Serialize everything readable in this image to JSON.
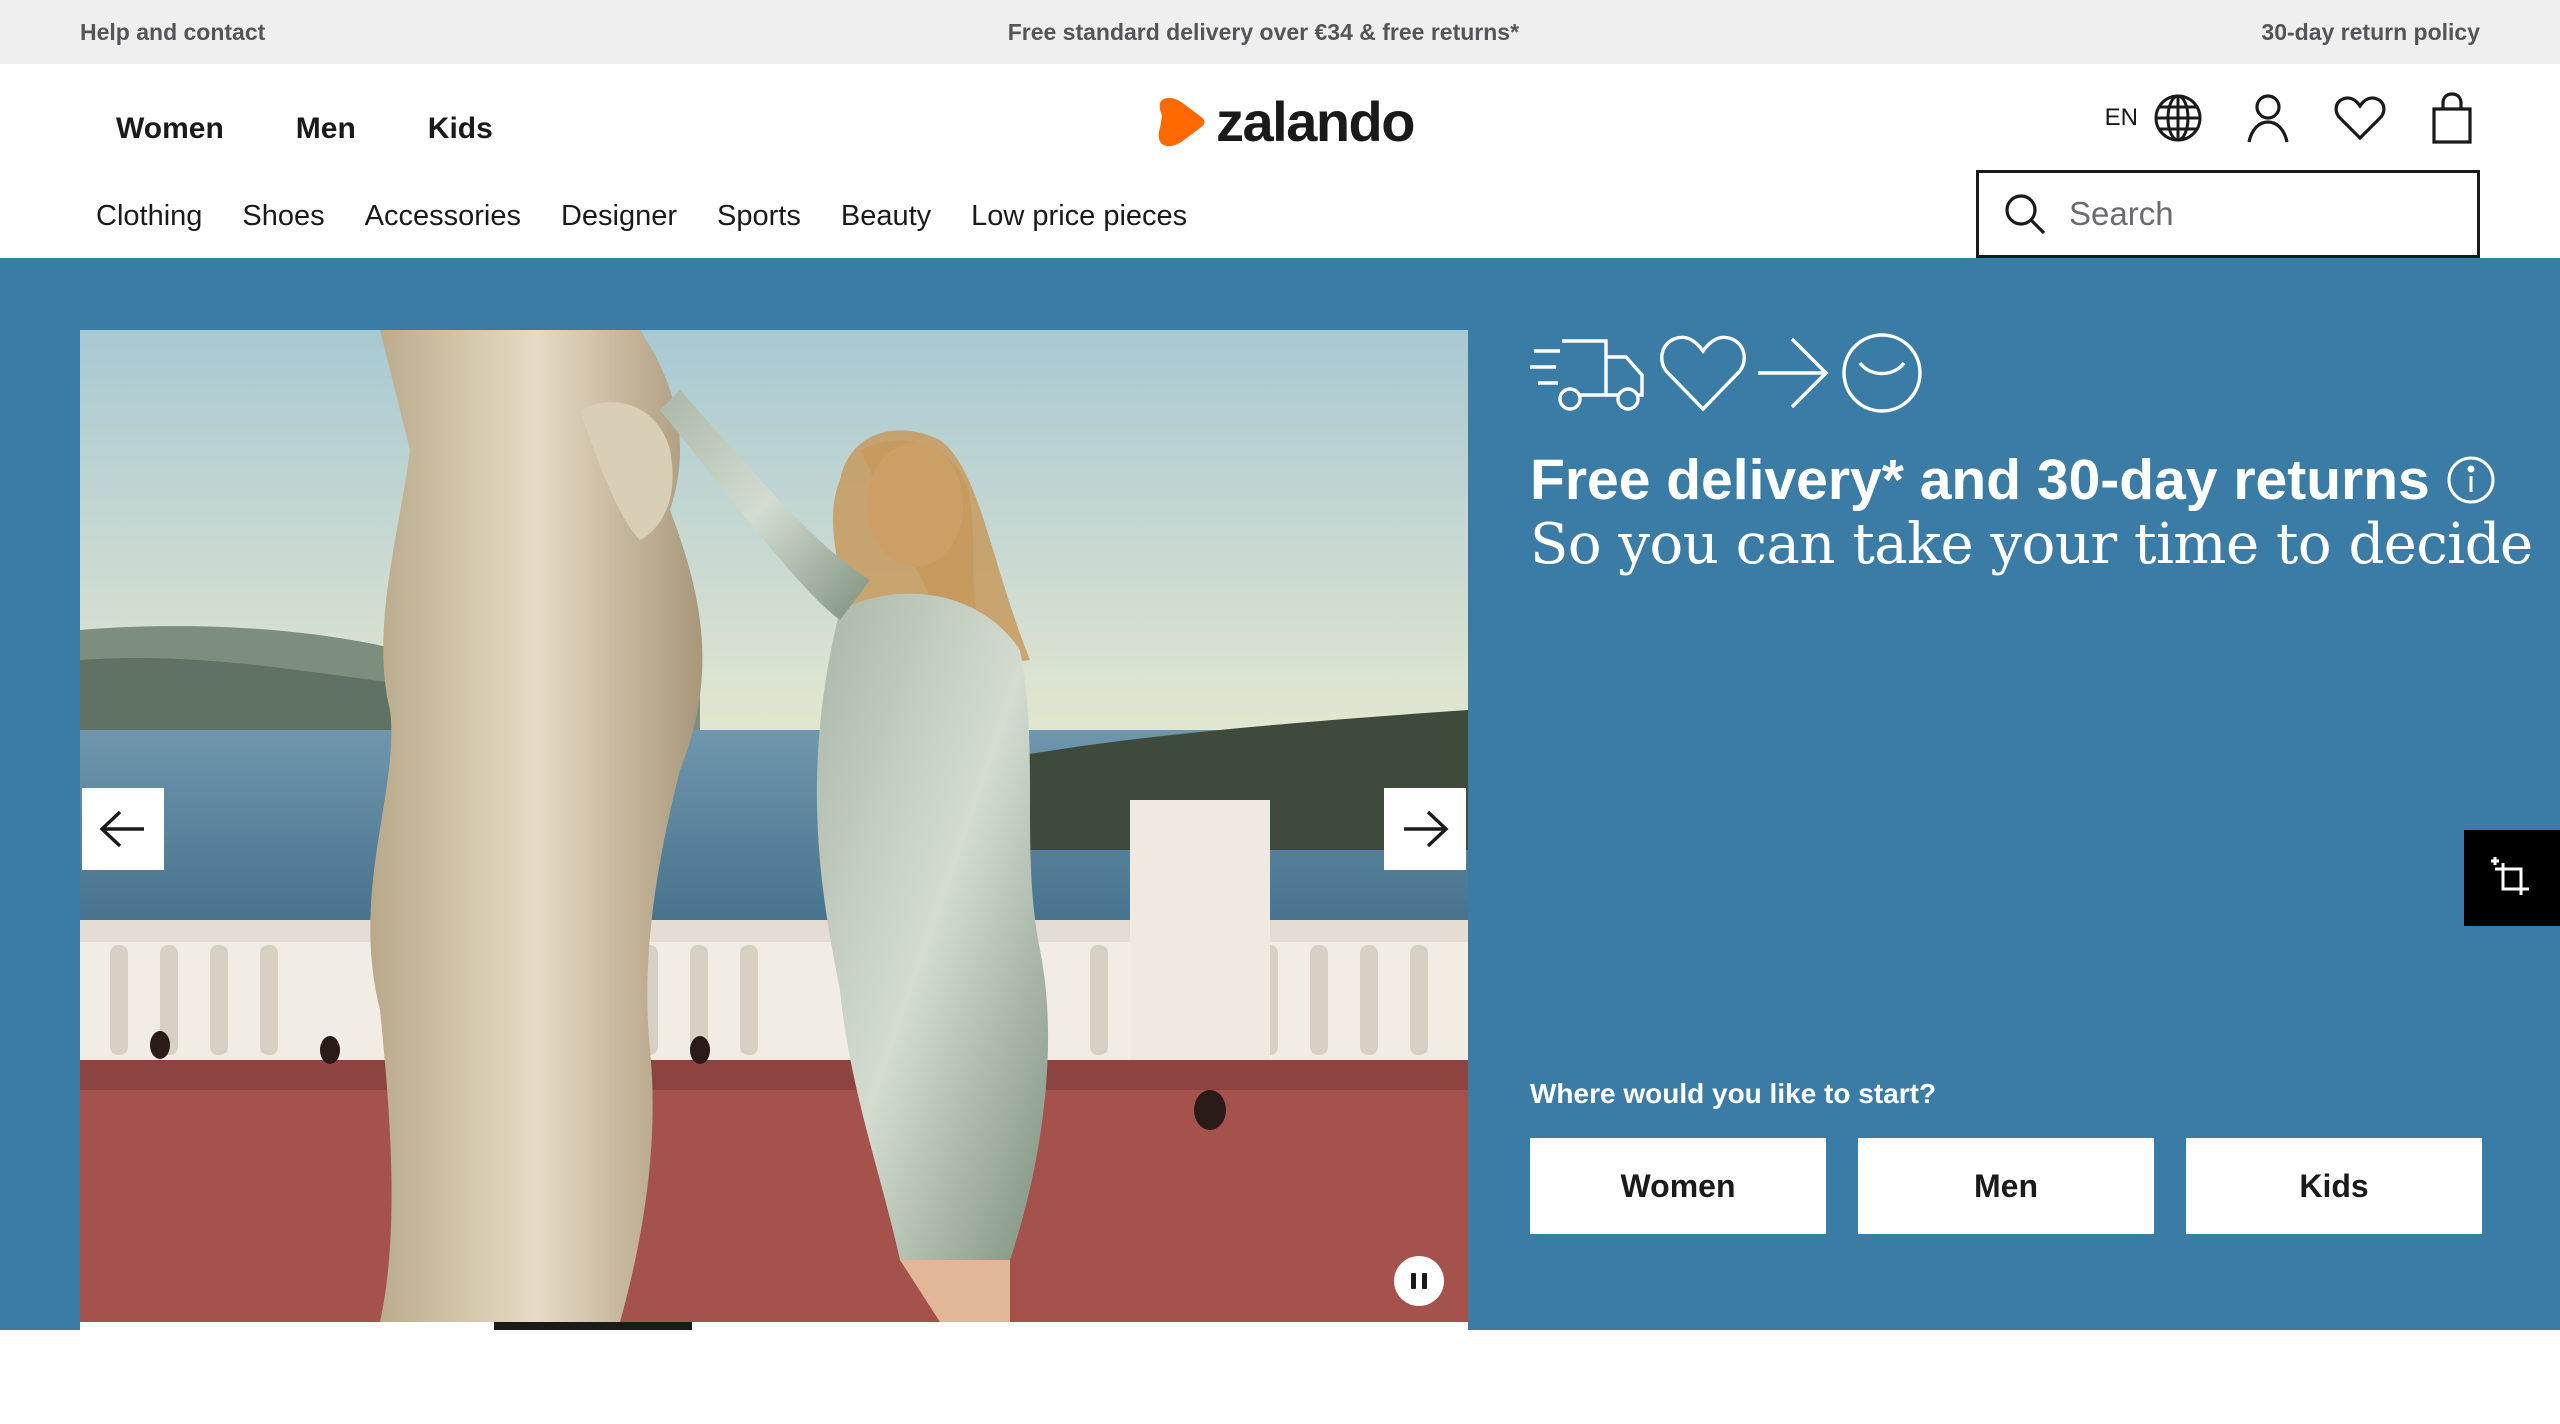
{
  "topbar": {
    "help": "Help and contact",
    "delivery": "Free standard delivery over €34 & free returns*",
    "returns": "30-day return policy"
  },
  "header": {
    "gender_nav": [
      "Women",
      "Men",
      "Kids"
    ],
    "logo_text": "zalando",
    "language": "EN",
    "icons": [
      "globe-icon",
      "account-icon",
      "wishlist-heart-icon",
      "shopping-bag-icon"
    ],
    "categories": [
      "Clothing",
      "Shoes",
      "Accessories",
      "Designer",
      "Sports",
      "Beauty",
      "Low price pieces"
    ],
    "search_placeholder": "Search"
  },
  "hero": {
    "carousel_progress": 0.2,
    "promo_title": "Free delivery* and 30-day returns",
    "promo_subtitle": "So you can take your time to decide",
    "start_question": "Where would you like to start?",
    "start_buttons": [
      "Women",
      "Men",
      "Kids"
    ]
  },
  "colors": {
    "hero_bg": "#3b7ca6",
    "brand_orange": "#ff6900",
    "topbar_bg": "#efeff0"
  }
}
